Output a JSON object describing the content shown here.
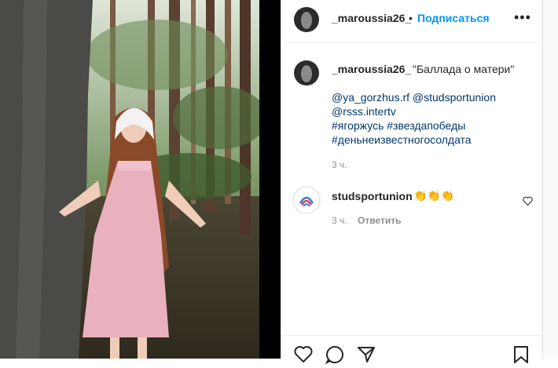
{
  "post": {
    "author": "_maroussia26_",
    "dot": "•",
    "follow_label": "Подписаться",
    "more_label": "•••",
    "caption": "\"Баллада о матери\"",
    "tags": [
      "@ya_gorzhus.rf @studsportunion",
      "@rsss.intertv",
      "#ягоржусь #звездапобеды",
      "#деньнеизвестногосолдата"
    ],
    "caption_time": "3 ч."
  },
  "comment": {
    "author": "studsportunion",
    "text": "👏👏👏",
    "time": "3 ч.",
    "reply_label": "Ответить"
  },
  "icons": [
    "ellipsis-icon",
    "heart-icon",
    "comment-icon",
    "share-icon",
    "bookmark-icon"
  ],
  "colors": {
    "link": "#0095f6",
    "tag": "#00376b",
    "muted": "#8e8e8e",
    "text": "#262626"
  }
}
